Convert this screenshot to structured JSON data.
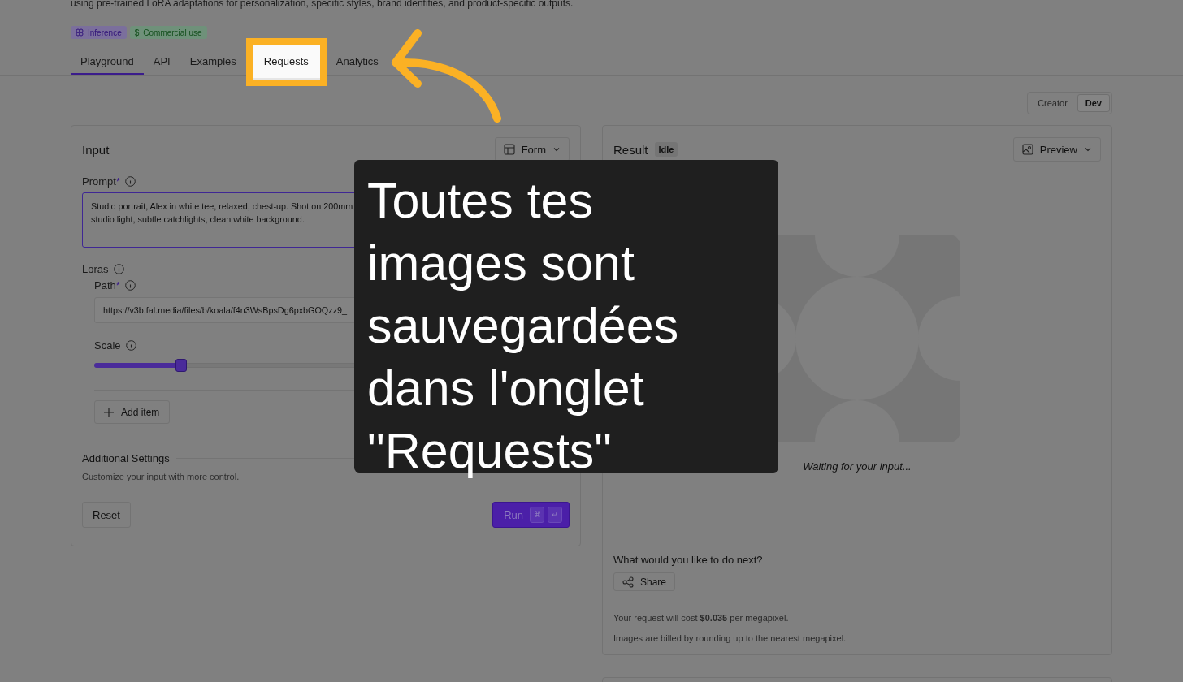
{
  "description": "using pre-trained LoRA adaptations for personalization, specific styles, brand identities, and product-specific outputs.",
  "tags": [
    {
      "kind": "inference",
      "label": "Inference"
    },
    {
      "kind": "commercial",
      "symbol": "$",
      "label": "Commercial use"
    }
  ],
  "tabs": [
    {
      "label": "Playground",
      "selected": true,
      "highlighted": false
    },
    {
      "label": "API",
      "selected": false,
      "highlighted": false
    },
    {
      "label": "Examples",
      "selected": false,
      "highlighted": false
    },
    {
      "label": "Requests",
      "selected": false,
      "highlighted": true
    },
    {
      "label": "Analytics",
      "selected": false,
      "highlighted": false
    }
  ],
  "mode_toggle": [
    {
      "label": "Creator",
      "selected": false
    },
    {
      "label": "Dev",
      "selected": true
    }
  ],
  "input_panel": {
    "title": "Input",
    "view_button": "Form",
    "prompt": {
      "label": "Prompt",
      "required_mark": "*",
      "lines": [
        "Studio portrait, Alex in white tee, relaxed, chest-up. Shot on 200mm",
        "studio light, subtle catchlights, clean white background."
      ]
    },
    "loras": {
      "label": "Loras",
      "path": {
        "label": "Path",
        "required_mark": "*",
        "value": "https://v3b.fal.media/files/b/koala/f4n3WsBpsDg6pxbGOQzz9_"
      },
      "scale": {
        "label": "Scale",
        "level": 0.21
      },
      "add_button": "Add item"
    },
    "additional": {
      "title": "Additional Settings",
      "description": "Customize your input with more control."
    },
    "reset_button": "Reset",
    "run_button": {
      "label": "Run",
      "keys": [
        "⌘",
        "↵"
      ]
    }
  },
  "result_panel": {
    "title": "Result",
    "status": "Idle",
    "view_button": "Preview",
    "waiting_text": "Waiting for your input...",
    "next_title": "What would you like to do next?",
    "share_button": "Share",
    "cost_text": "Your request will cost **$0.035** per megapixel.",
    "billing_note": "Images are billed by rounding up to the nearest megapixel."
  },
  "callout": {
    "text": "Toutes tes images sont sauvegardées dans l'onglet \"Requests\""
  }
}
